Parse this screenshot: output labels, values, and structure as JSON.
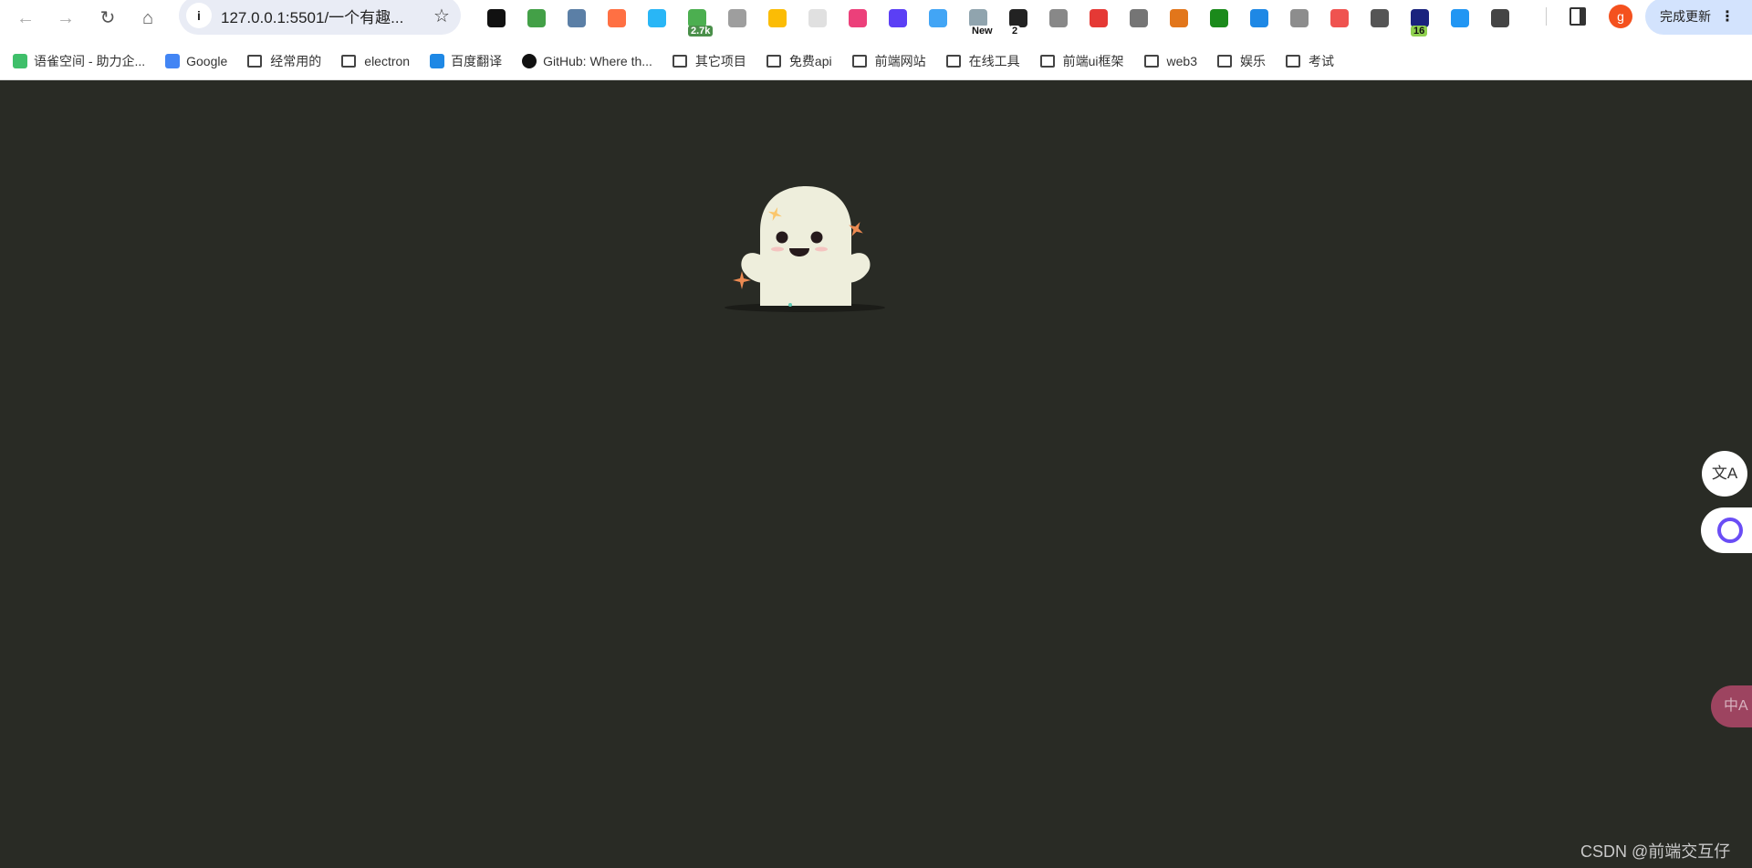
{
  "browser": {
    "address_url": "127.0.0.1:5501/一个有趣...",
    "update_button": "完成更新",
    "profile_initial": "g",
    "extensions": [
      {
        "name": "tampermonkey",
        "color": "#111111"
      },
      {
        "name": "shield",
        "color": "#43a047"
      },
      {
        "name": "bookmark-star",
        "color": "#5b7fa6"
      },
      {
        "name": "orange-circle",
        "color": "#ff7043"
      },
      {
        "name": "bowl",
        "color": "#29b6f6"
      },
      {
        "name": "green-ext",
        "color": "#4caf50",
        "badge": "2.7k"
      },
      {
        "name": "face",
        "color": "#9e9e9e"
      },
      {
        "name": "color-ring",
        "color": "#fbbc05"
      },
      {
        "name": "grid-ext",
        "color": "#e0e0e0"
      },
      {
        "name": "translate-zh",
        "color": "#ec407a"
      },
      {
        "name": "monica",
        "color": "#5b3ff5"
      },
      {
        "name": "screenshot",
        "color": "#42a5f5"
      },
      {
        "name": "new-ext",
        "color": "#90a4ae",
        "badge": "New"
      },
      {
        "name": "dark-ext",
        "color": "#222222",
        "badge": "2"
      },
      {
        "name": "y-ext",
        "color": "#888888"
      },
      {
        "name": "chrome-dark",
        "color": "#e53935"
      },
      {
        "name": "copy-ext",
        "color": "#757575"
      },
      {
        "name": "metamask",
        "color": "#e2761b"
      },
      {
        "name": "download-arrow",
        "color": "#1b8a1b"
      },
      {
        "name": "eye-ext",
        "color": "#1e88e5"
      },
      {
        "name": "n-ext",
        "color": "#8d8d8d"
      },
      {
        "name": "confetti",
        "color": "#ef5350"
      },
      {
        "name": "a-ext",
        "color": "#555555"
      },
      {
        "name": "blue-ext",
        "color": "#1a237e",
        "badge": "16"
      },
      {
        "name": "person-ext",
        "color": "#2196f3"
      },
      {
        "name": "puzzle",
        "color": "#444444"
      }
    ],
    "bookmarks": [
      {
        "label": "语雀空间 - 助力企...",
        "icon": "yuque"
      },
      {
        "label": "Google",
        "icon": "google"
      },
      {
        "label": "经常用的",
        "icon": "folder"
      },
      {
        "label": "electron",
        "icon": "folder"
      },
      {
        "label": "百度翻译",
        "icon": "baidu-translate"
      },
      {
        "label": "GitHub: Where th...",
        "icon": "github"
      },
      {
        "label": "其它项目",
        "icon": "folder"
      },
      {
        "label": "免费api",
        "icon": "folder"
      },
      {
        "label": "前端网站",
        "icon": "folder"
      },
      {
        "label": "在线工具",
        "icon": "folder"
      },
      {
        "label": "前端ui框架",
        "icon": "folder"
      },
      {
        "label": "web3",
        "icon": "folder"
      },
      {
        "label": "娱乐",
        "icon": "folder"
      },
      {
        "label": "考试",
        "icon": "folder"
      }
    ]
  },
  "page": {
    "background": "#292b25",
    "ghost_color": "#eeeedc",
    "translate_fab": "文A",
    "translate_fab2": "中A",
    "watermark": "CSDN @前端交互仔"
  }
}
